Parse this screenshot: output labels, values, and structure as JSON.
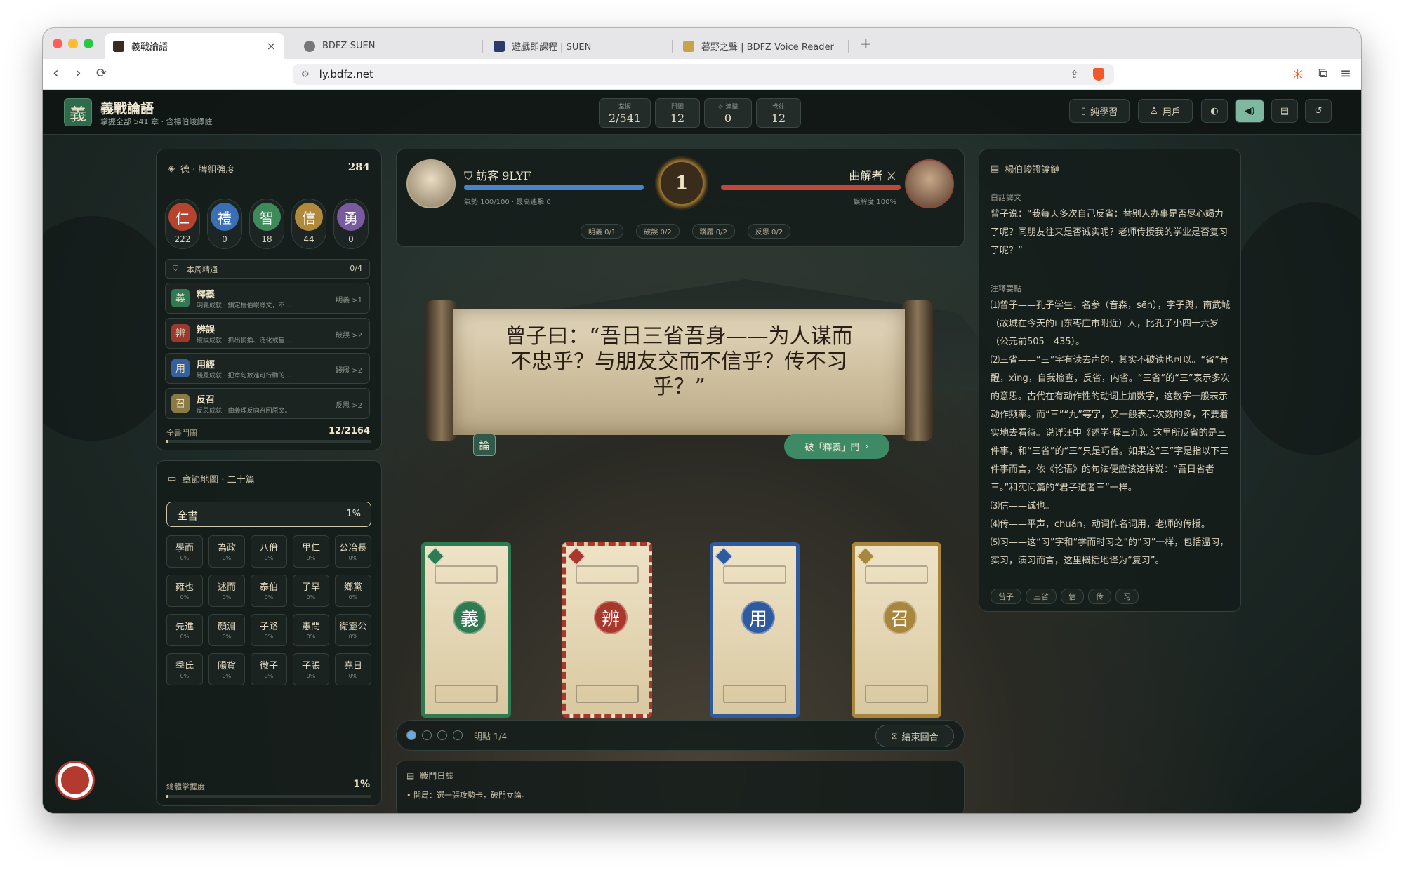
{
  "browser": {
    "tabs": [
      {
        "title": "義戰論語",
        "active": true
      },
      {
        "title": "BDFZ-SUEN"
      },
      {
        "title": "遊戲即課程 | SUEN"
      },
      {
        "title": "暮野之聲 | BDFZ Voice Reader"
      }
    ],
    "new_tab": "+",
    "close_glyph": "×",
    "url": "ly.bdfz.net"
  },
  "app": {
    "logo": "義",
    "title": "義戰論語",
    "subtitle": "掌握全部 541 章 · 含楊伯峻譯註",
    "stats": [
      {
        "label": "掌握",
        "value": "2/541"
      },
      {
        "label": "鬥圖",
        "value": "12"
      },
      {
        "label": "☼ 連擊",
        "value": "0"
      },
      {
        "label": "卷往",
        "value": "12"
      }
    ],
    "buttons": {
      "study": "純學習",
      "user": "用戶"
    }
  },
  "virtue_panel": {
    "title": "德 · 牌組強度",
    "score": "284",
    "virtues": [
      {
        "glyph": "仁",
        "value": "222",
        "color": "#b5432e"
      },
      {
        "glyph": "禮",
        "value": "0",
        "color": "#3b6fb4"
      },
      {
        "glyph": "智",
        "value": "18",
        "color": "#3f8a5a"
      },
      {
        "glyph": "信",
        "value": "44",
        "color": "#b08a3a"
      },
      {
        "glyph": "勇",
        "value": "0",
        "color": "#7a5a9e"
      }
    ],
    "weekly_title": "本周精通",
    "weekly_count": "0/4",
    "skills": [
      {
        "glyph": "義",
        "title": "釋義",
        "desc": "明義成就 · 鎖定楊伯峻譯文，不…",
        "req": "明義 >1",
        "color": "#2f7a50"
      },
      {
        "glyph": "辨",
        "title": "辨誤",
        "desc": "破誤成就 · 抓出偷換、泛化或望…",
        "req": "破誤 >2",
        "color": "#9a3a2e"
      },
      {
        "glyph": "用",
        "title": "用經",
        "desc": "踐履成就 · 把章句放進可行動的…",
        "req": "踐履 >2",
        "color": "#34609e"
      },
      {
        "glyph": "召",
        "title": "反召",
        "desc": "反思成就 · 由義理反向召回原文。",
        "req": "反思 >2",
        "color": "#8c7a44"
      }
    ],
    "total_label": "全書鬥圖",
    "total_value": "12/2164"
  },
  "chapter_panel": {
    "title": "章節地圖 · 二十篇",
    "all_label": "全書",
    "all_pct": "1%",
    "chapters": [
      {
        "name": "學而",
        "pct": "0%"
      },
      {
        "name": "為政",
        "pct": "0%"
      },
      {
        "name": "八佾",
        "pct": "0%"
      },
      {
        "name": "里仁",
        "pct": "0%"
      },
      {
        "name": "公冶長",
        "pct": "0%"
      },
      {
        "name": "雍也",
        "pct": "0%"
      },
      {
        "name": "述而",
        "pct": "0%"
      },
      {
        "name": "泰伯",
        "pct": "0%"
      },
      {
        "name": "子罕",
        "pct": "0%"
      },
      {
        "name": "鄉黨",
        "pct": "0%"
      },
      {
        "name": "先進",
        "pct": "0%"
      },
      {
        "name": "顏淵",
        "pct": "0%"
      },
      {
        "name": "子路",
        "pct": "0%"
      },
      {
        "name": "憲問",
        "pct": "0%"
      },
      {
        "name": "衛靈公",
        "pct": "0%"
      },
      {
        "name": "季氏",
        "pct": "0%"
      },
      {
        "name": "陽貨",
        "pct": "0%"
      },
      {
        "name": "微子",
        "pct": "0%"
      },
      {
        "name": "子張",
        "pct": "0%"
      },
      {
        "name": "堯日",
        "pct": "0%"
      }
    ],
    "overall_label": "總體掌握度",
    "overall_value": "1%"
  },
  "battle": {
    "player_name": "訪客 9LYF",
    "player_stat": "氣勢 100/100 · 最高連擊 0",
    "round": "1",
    "enemy_name": "曲解者",
    "enemy_stat": "誤解度 100%",
    "chips": [
      "明義 0/1",
      "破誤 0/2",
      "踐履 0/2",
      "反思 0/2"
    ],
    "quote": "曾子曰：“吾日三省吾身——为人谋而不忠乎？与朋友交而不信乎？传不习乎？”",
    "scroll_badge": "論",
    "action": "破「釋義」門",
    "cards": [
      {
        "glyph": "義",
        "color": "#2f7a50"
      },
      {
        "glyph": "辨",
        "color": "#a8382c"
      },
      {
        "glyph": "用",
        "color": "#2f5a9e"
      },
      {
        "glyph": "召",
        "color": "#a8863e"
      }
    ],
    "phase": "明點 1/4",
    "end_turn": "結束回合",
    "log_title": "戰鬥日誌",
    "log_line": "開局：選一張攻勢卡，破門立論。"
  },
  "notes": {
    "title": "楊伯峻證論鏈",
    "section1": "白話譯文",
    "translation": "曾子说：“我每天多次自己反省：替别人办事是否尽心竭力了呢？同朋友往来是否诚实呢？老师传授我的学业是否复习了呢？”",
    "section2": "注釋要點",
    "notes": [
      "⑴曾子——孔子学生，名参（音森，sēn），字子舆，南武城（故城在今天的山东枣庄市附近）人，比孔子小四十六岁（公元前505—435）。",
      "⑵三省——“三”字有读去声的，其实不破读也可以。“省”音醒，xǐng，自我检查，反省，内省。“三省”的“三”表示多次的意思。古代在有动作性的动词上加数字，这数字一般表示动作频率。而“三”“九”等字，又一般表示次数的多，不要着实地去看待。说详汪中《述学·释三九》。这里所反省的是三件事，和“三省”的“三”只是巧合。如果这“三”字是指以下三件事而言，依《论语》的句法便应该这样说：“吾日省者三。”和宪问篇的“君子道者三”一样。",
      "⑶信——诚也。",
      "⑷传——平声，chuán，动词作名词用，老师的传授。",
      "⑸习——这“习”字和“学而时习之”的“习”一样，包括温习，实习，演习而言，这里概括地译为“复习”。"
    ],
    "tags": [
      "曾子",
      "三省",
      "信",
      "传",
      "习"
    ]
  }
}
